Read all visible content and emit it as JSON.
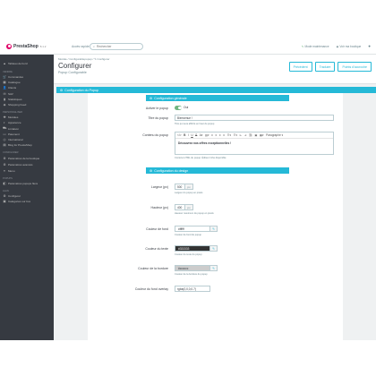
{
  "header": {
    "logo_text": "PrestaShop",
    "version": "8.1.2",
    "quick_access": "Accès rapide",
    "search_placeholder": "Rechercher",
    "maintenance": "Mode maintenance",
    "view_shop": "Voir ma boutique"
  },
  "sidebar": {
    "dashboard": "Tableau de bord",
    "sections": [
      {
        "title": "VENDRE",
        "items": [
          {
            "icon": "cart-icon",
            "glyph": "🛒",
            "label": "Commandes"
          },
          {
            "icon": "store-icon",
            "glyph": "▦",
            "label": "Catalogue"
          },
          {
            "icon": "clients-icon",
            "glyph": "👤",
            "label": "Clients"
          },
          {
            "icon": "sav-icon",
            "glyph": "✉",
            "label": "SAV"
          },
          {
            "icon": "stats-icon",
            "glyph": "▮",
            "label": "Statistiques"
          },
          {
            "icon": "feed-icon",
            "glyph": "◈",
            "label": "Shopping Feed"
          }
        ]
      },
      {
        "title": "PERSONNALISER",
        "items": [
          {
            "icon": "modules-icon",
            "glyph": "✚",
            "label": "Modules"
          },
          {
            "icon": "appearance-icon",
            "glyph": "◐",
            "label": "Apparence"
          },
          {
            "icon": "shipping-icon",
            "glyph": "⛟",
            "label": "Livraison"
          },
          {
            "icon": "payment-icon",
            "glyph": "▭",
            "label": "Paiement"
          },
          {
            "icon": "international-icon",
            "glyph": "◎",
            "label": "International"
          },
          {
            "icon": "blog-icon",
            "glyph": "▤",
            "label": "Blog for PrestaShop"
          }
        ]
      },
      {
        "title": "CONFIGURER",
        "items": [
          {
            "icon": "settings-icon",
            "glyph": "⚙",
            "label": "Paramètres de la boutique",
            "multi": true
          },
          {
            "icon": "advanced-icon",
            "glyph": "⚙",
            "label": "Paramètres avancés"
          },
          {
            "icon": "menu-icon",
            "glyph": "≡",
            "label": "Menu"
          }
        ]
      },
      {
        "title": "POPUPS",
        "items": [
          {
            "icon": "popup-icon",
            "glyph": "◧",
            "label": "Paramètres popups flexs"
          }
        ]
      },
      {
        "title": "ALAN",
        "items": [
          {
            "icon": "config-icon",
            "glyph": "⚙",
            "label": "Configurer"
          },
          {
            "icon": "categories-icon",
            "glyph": "▣",
            "label": "Catégories sur box"
          }
        ]
      }
    ]
  },
  "toolbar": {
    "breadcrumb": "Module  /  Configurablepopup  /  ✎ Configurer",
    "title": "Configurer",
    "subtitle": "Popup Configurable",
    "buttons": [
      "Précédent",
      "Traduire",
      "Points d'accroche"
    ]
  },
  "main": {
    "section_title": "Configuration du Popup",
    "general_title": "Configuration générale",
    "design_title": "Configuration du design",
    "fields": {
      "activate_label": "Activer le popup",
      "activate_value": "Oui",
      "title_label": "Titre du popup",
      "title_value": "Bienvenue !",
      "title_help": "Titre qui sera affiché en haut du popup",
      "content_label": "Contenu du popup",
      "editor_format": "Paragraphe",
      "content_value": "Découvrez nos offres exceptionnelles !",
      "content_help": "Contenu HTML du popup. Éditeur riche disponible",
      "width_label": "Largeur (px)",
      "width_value": "500",
      "width_unit": "px",
      "width_help": "Largeur du popup en pixels",
      "height_label": "Hauteur (px)",
      "height_value": "400",
      "height_unit": "px",
      "height_help": "Hauteur maximum du popup en pixels",
      "bg_label": "Couleur de fond",
      "bg_value": "#ffffff",
      "bg_help": "Couleur de fond du popup",
      "text_label": "Couleur du texte",
      "text_value": "#333333",
      "text_help": "Couleur du texte du popup",
      "border_label": "Couleur de la bordure",
      "border_value": "#cccccc",
      "border_help": "Couleur de la bordure du popup",
      "overlay_label": "Couleur du fond overlay",
      "overlay_value": "rgba(0,0,0,0.7)"
    }
  },
  "colors": {
    "accent": "#25b9d7",
    "sidebar": "#363a41",
    "toggle_on": "#70b580",
    "brand": "#df0067"
  }
}
